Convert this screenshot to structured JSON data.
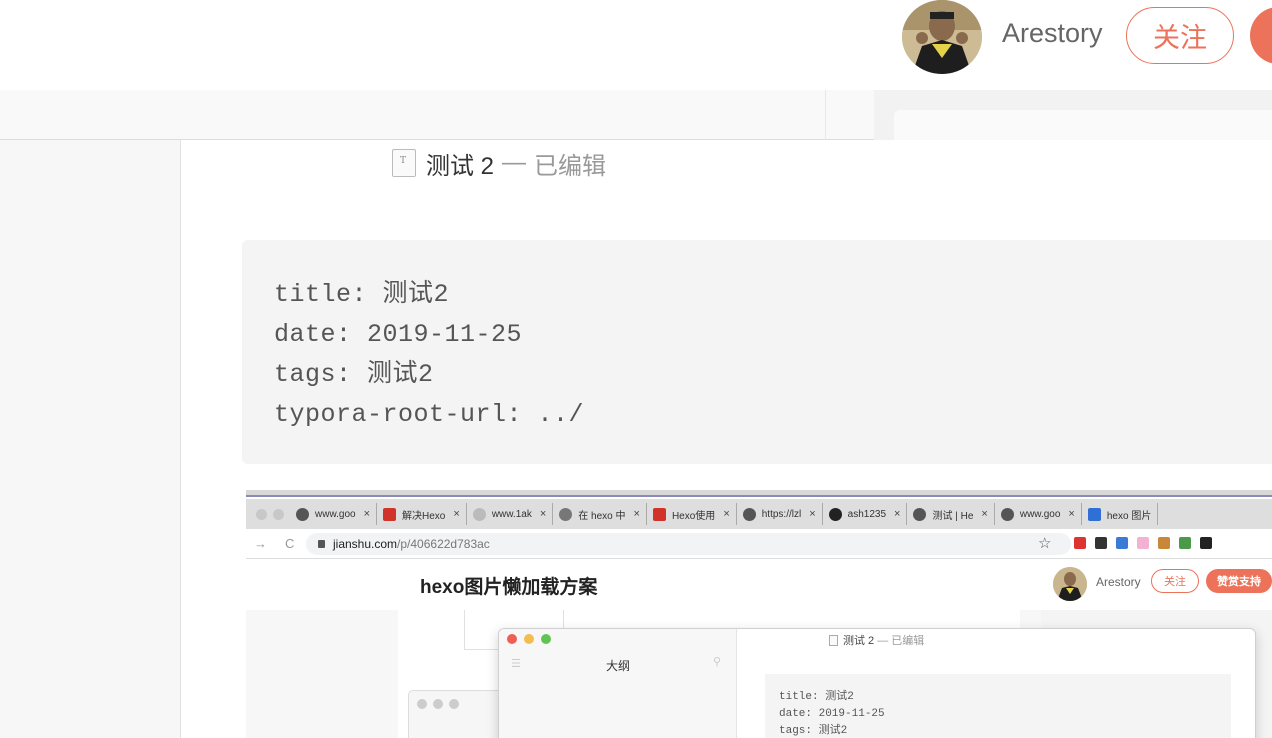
{
  "header": {
    "author": "Arestory",
    "follow_label": "关注"
  },
  "document": {
    "name": "测试 2",
    "separator": "—",
    "status": "已编辑",
    "front_matter": [
      "title: 测试2",
      "date: 2019-11-25",
      "tags: 测试2",
      "typora-root-url: ../"
    ]
  },
  "nested_browser": {
    "tabs": [
      {
        "label": "www.goo",
        "icon": "globe-icon"
      },
      {
        "label": "解决Hexo",
        "icon": "csdn-icon"
      },
      {
        "label": "www.1ak",
        "icon": "loading-icon"
      },
      {
        "label": "在 hexo 中",
        "icon": "hexo-icon"
      },
      {
        "label": "Hexo使用",
        "icon": "jianshu-icon"
      },
      {
        "label": "https://lzl",
        "icon": "globe-icon"
      },
      {
        "label": "ash1235",
        "icon": "github-icon"
      },
      {
        "label": "测试 | He",
        "icon": "globe-icon"
      },
      {
        "label": "www.goo",
        "icon": "globe-icon"
      },
      {
        "label": "hexo 图片",
        "icon": "baidu-icon"
      }
    ],
    "tab_close": "×",
    "url_host": "jianshu.com",
    "url_path": "/p/406622d783ac",
    "page_title": "hexo图片懒加载方案",
    "author": "Arestory",
    "follow_label": "关注",
    "reward_label": "赞赏支持",
    "editor": {
      "outline_label": "大纲",
      "title_name": "测试 2",
      "title_status": "— 已编辑",
      "code_lines": [
        "title: 测试2",
        "date: 2019-11-25",
        "tags: 测试2"
      ]
    }
  },
  "colors": {
    "accent": "#ec7259"
  }
}
